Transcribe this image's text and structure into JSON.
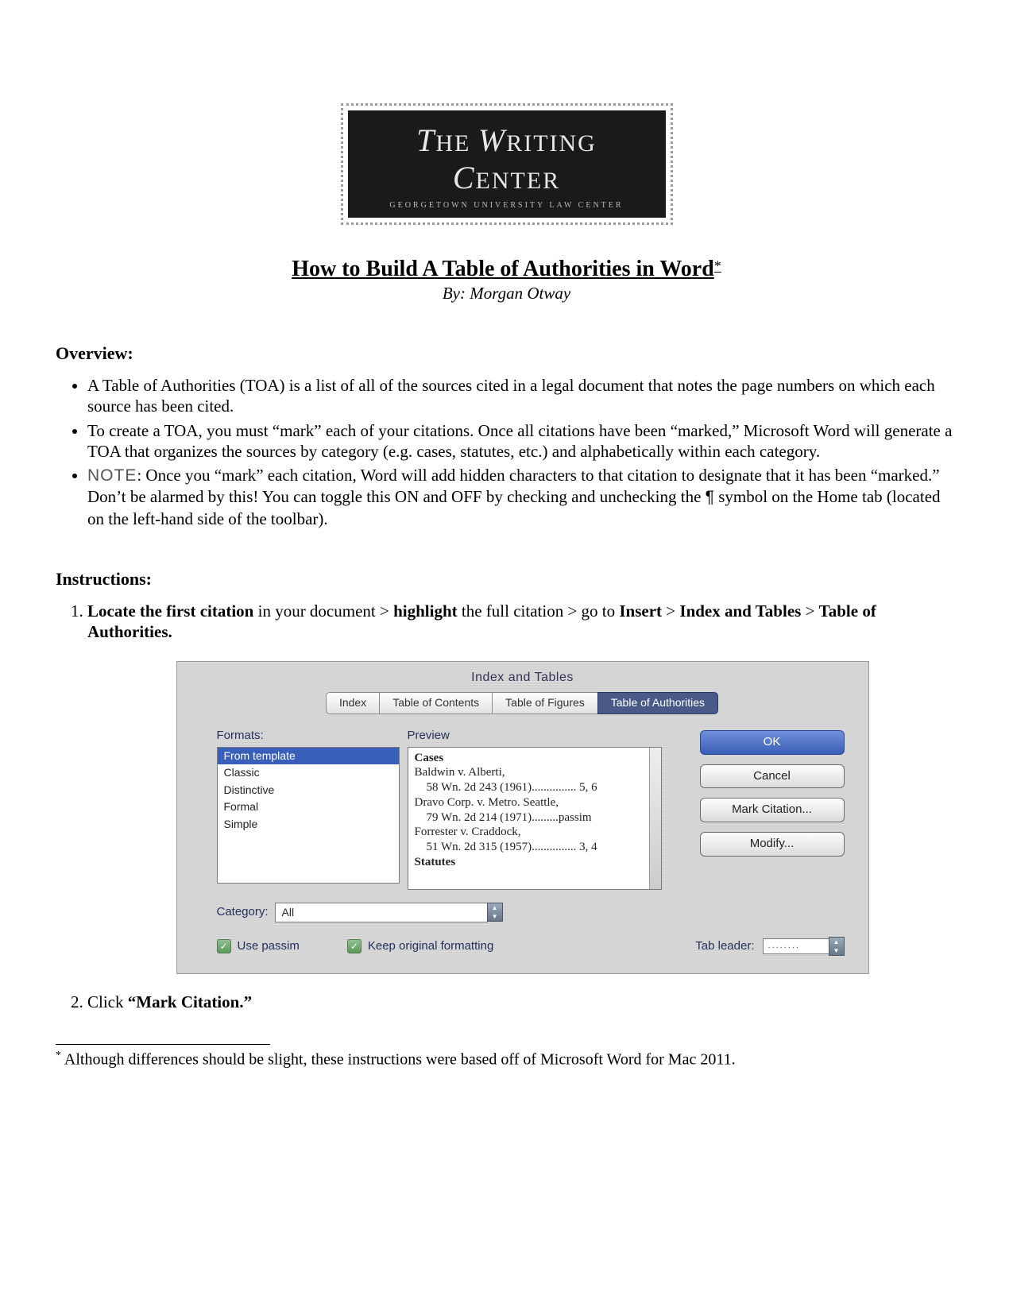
{
  "logo": {
    "title_prefix": "T",
    "title_mid1": "HE ",
    "title_big2": "W",
    "title_mid2": "RITING ",
    "title_big3": "C",
    "title_end": "ENTER",
    "subtitle": "GEORGETOWN UNIVERSITY LAW CENTER"
  },
  "doc": {
    "title": "How to Build A Table of Authorities in Word",
    "asterisk": "*",
    "byline": "By: Morgan Otway"
  },
  "sections": {
    "overview_head": "Overview:",
    "instructions_head": "Instructions:"
  },
  "overview": {
    "b1": "A Table of Authorities (TOA) is a list of all of the sources cited in a legal document that notes the page numbers on which each source has been cited.",
    "b2": "To create a TOA, you must “mark” each of your citations. Once all citations have been “marked,” Microsoft Word will generate a TOA that organizes the sources by category (e.g. cases, statutes, etc.) and alphabetically within each category.",
    "b3_note": "NOTE",
    "b3_rest": ": Once you “mark” each citation, Word will add hidden characters to that citation to designate that it has been “marked.” Don’t be alarmed by this! You can toggle this ON and OFF by checking and unchecking the ",
    "b3_pilcrow": "¶",
    "b3_tail": " symbol on the Home tab (located on the left-hand side of the toolbar)."
  },
  "steps": {
    "s1_a": "Locate the first citation",
    "s1_b": " in your document > ",
    "s1_c": "highlight",
    "s1_d": " the full citation > go to ",
    "s1_e": "Insert",
    "s1_f": " > ",
    "s1_g": "Index and Tables",
    "s1_h": " > ",
    "s1_i": "Table of Authorities.",
    "s2_a": "Click ",
    "s2_b": "“Mark Citation.”"
  },
  "dialog": {
    "title": "Index and Tables",
    "tabs": [
      "Index",
      "Table of Contents",
      "Table of Figures",
      "Table of Authorities"
    ],
    "formats_label": "Formats:",
    "formats": [
      "From template",
      "Classic",
      "Distinctive",
      "Formal",
      "Simple"
    ],
    "preview_label": "Preview",
    "preview": {
      "h1": "Cases",
      "l1": "Baldwin v. Alberti,",
      "l2": "    58 Wn. 2d 243 (1961)............... 5, 6",
      "l3": "Dravo Corp. v. Metro. Seattle,",
      "l4": "    79 Wn. 2d 214 (1971).........passim",
      "l5": "Forrester v. Craddock,",
      "l6": "    51 Wn. 2d 315 (1957)............... 3, 4",
      "h2": "Statutes"
    },
    "buttons": {
      "ok": "OK",
      "cancel": "Cancel",
      "mark": "Mark Citation...",
      "modify": "Modify..."
    },
    "category_label": "Category:",
    "category_value": "All",
    "use_passim": "Use passim",
    "keep_formatting": "Keep original formatting",
    "tab_leader_label": "Tab leader:",
    "tab_leader_value": "........"
  },
  "footnote": {
    "mark": "*",
    "text": " Although differences should be slight, these instructions were based off of Microsoft Word for Mac 2011."
  }
}
